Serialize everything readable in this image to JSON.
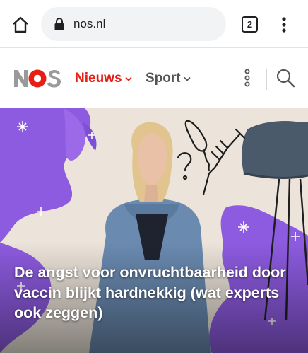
{
  "browser": {
    "url": "nos.nl",
    "tab_count": "2",
    "icons": {
      "home": "home-icon",
      "lock": "lock-icon",
      "menu": "more-vertical-icon"
    }
  },
  "site": {
    "logo_text": "NOS",
    "nav": [
      {
        "label": "Nieuws",
        "active": true
      },
      {
        "label": "Sport",
        "active": false
      }
    ],
    "colors": {
      "brand_red": "#e61e14",
      "nav_grey": "#555555",
      "illustration_purple": "#8d5be0"
    }
  },
  "article": {
    "headline": "De angst voor onvruchtbaarheid door vaccin blijkt hardnekkig (wat experts ook zeggen)"
  }
}
